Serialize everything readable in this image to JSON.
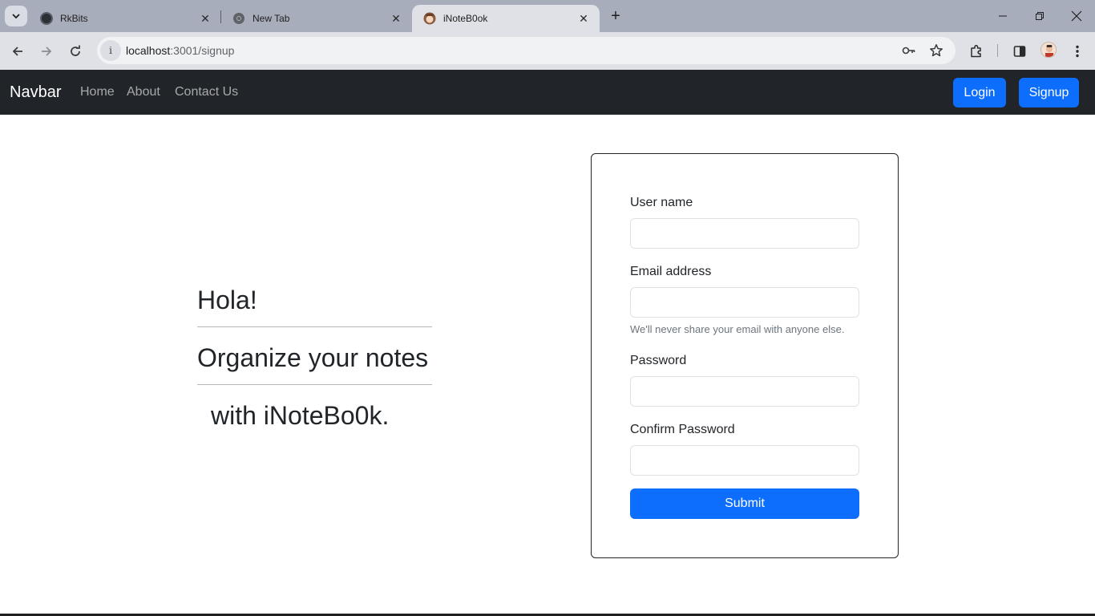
{
  "browser": {
    "tabs": [
      {
        "title": "RkBits"
      },
      {
        "title": "New Tab"
      },
      {
        "title": "iNoteB0ok"
      }
    ],
    "url_host": "localhost",
    "url_path": ":3001/signup"
  },
  "navbar": {
    "brand": "Navbar",
    "links": [
      "Home",
      "About",
      "Contact Us"
    ],
    "login_label": "Login",
    "signup_label": "Signup"
  },
  "hero": {
    "line1": "Hola!",
    "line2": "Organize your notes",
    "line3": "with iNoteBo0k."
  },
  "form": {
    "username_label": "User name",
    "email_label": "Email address",
    "email_help": "We'll never share your email with anyone else.",
    "password_label": "Password",
    "confirm_label": "Confirm Password",
    "submit_label": "Submit"
  },
  "colors": {
    "primary": "#0d6efd",
    "navbar_bg": "#212529",
    "chrome_tabstrip": "#a8adbb",
    "chrome_toolbar": "#dfe1e6"
  }
}
